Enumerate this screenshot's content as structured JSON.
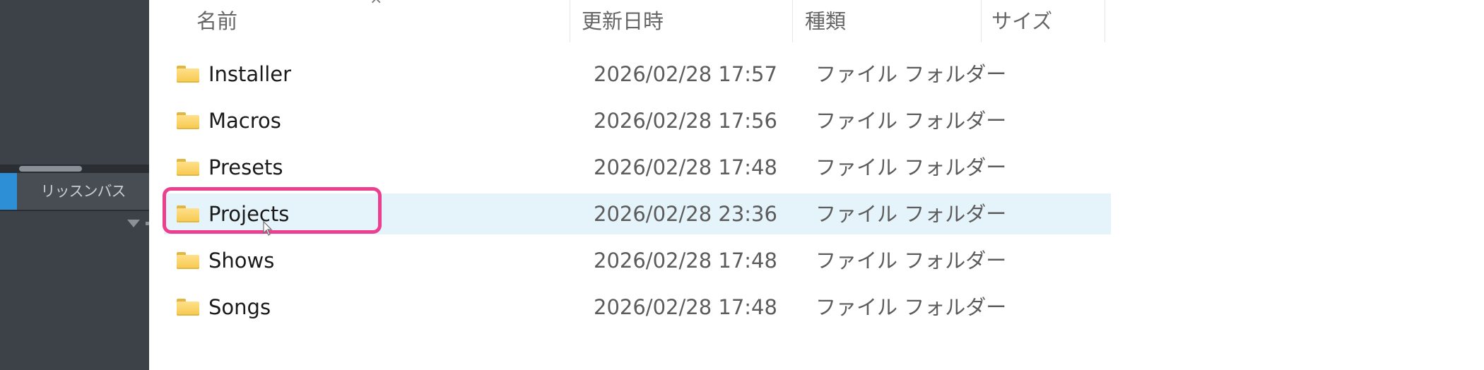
{
  "app_panel": {
    "track_label": "リッスンバス",
    "accent_color": "#2d8fd6"
  },
  "explorer": {
    "columns": {
      "name": "名前",
      "date": "更新日時",
      "type": "種類",
      "size": "サイズ"
    },
    "rows": [
      {
        "name": "Installer",
        "date": "2026/02/28 17:57",
        "type": "ファイル フォルダー",
        "selected": false
      },
      {
        "name": "Macros",
        "date": "2026/02/28 17:56",
        "type": "ファイル フォルダー",
        "selected": false
      },
      {
        "name": "Presets",
        "date": "2026/02/28 17:48",
        "type": "ファイル フォルダー",
        "selected": false
      },
      {
        "name": "Projects",
        "date": "2026/02/28 23:36",
        "type": "ファイル フォルダー",
        "selected": true
      },
      {
        "name": "Shows",
        "date": "2026/02/28 17:48",
        "type": "ファイル フォルダー",
        "selected": false
      },
      {
        "name": "Songs",
        "date": "2026/02/28 17:48",
        "type": "ファイル フォルダー",
        "selected": false
      }
    ],
    "selected_row_color": "#e5f3fb",
    "highlight_color": "#ec3f8e"
  },
  "icons": {
    "folder": "folder-icon",
    "dropdown": "chevron-down-icon",
    "close": "close-icon"
  }
}
